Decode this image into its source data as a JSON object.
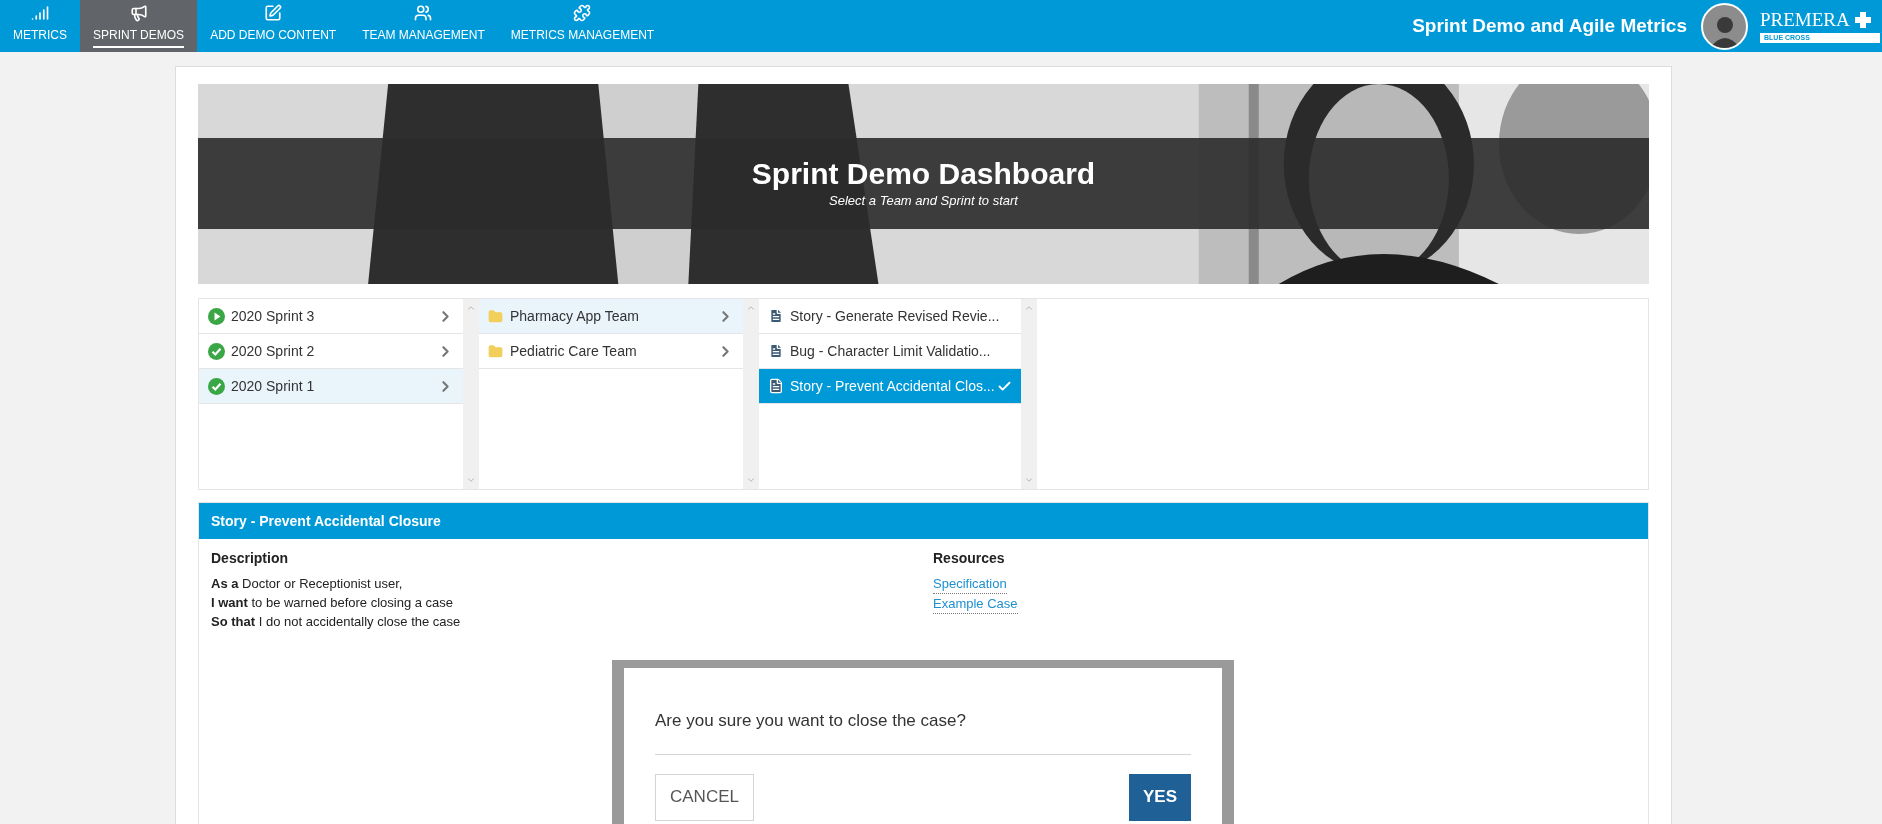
{
  "nav": {
    "items": [
      {
        "label": "METRICS",
        "selected": false
      },
      {
        "label": "SPRINT DEMOS",
        "selected": true
      },
      {
        "label": "ADD DEMO CONTENT",
        "selected": false
      },
      {
        "label": "TEAM MANAGEMENT",
        "selected": false
      },
      {
        "label": "METRICS MANAGEMENT",
        "selected": false
      }
    ],
    "app_title": "Sprint Demo and Agile Metrics",
    "logo": {
      "name": "PREMERA",
      "sub": "BLUE CROSS"
    }
  },
  "banner": {
    "kind": "picture",
    "title": "Sprint Demo Dashboard",
    "subtitle": "Select a Team and Sprint to start"
  },
  "sprints": [
    {
      "label": "2020 Sprint 3",
      "kind": "active",
      "selected": false
    },
    {
      "label": "2020 Sprint 2",
      "kind": "done",
      "selected": false
    },
    {
      "label": "2020 Sprint 1",
      "kind": "done",
      "selected": true
    }
  ],
  "teams": [
    {
      "label": "Pharmacy App Team",
      "selected": true
    },
    {
      "label": "Pediatric Care Team",
      "selected": false
    }
  ],
  "items": [
    {
      "label": "Story - Generate Revised Revie...",
      "selected": false
    },
    {
      "label": "Bug - Character Limit Validatio...",
      "selected": false
    },
    {
      "label": "Story - Prevent Accidental Clos...",
      "selected": true
    }
  ],
  "detail": {
    "title": "Story - Prevent Accidental Closure",
    "description_heading": "Description",
    "description_lines": [
      "**As a** Doctor or Receptionist user,",
      "**I want** to be warned before closing a case",
      "**So that** I do not accidentally close the case"
    ],
    "resources_heading": "Resources",
    "resources": [
      "Specification",
      "Example Case"
    ]
  },
  "dialog": {
    "message": "Are you sure you want to close the case?",
    "cancel": "CANCEL",
    "confirm": "YES"
  }
}
